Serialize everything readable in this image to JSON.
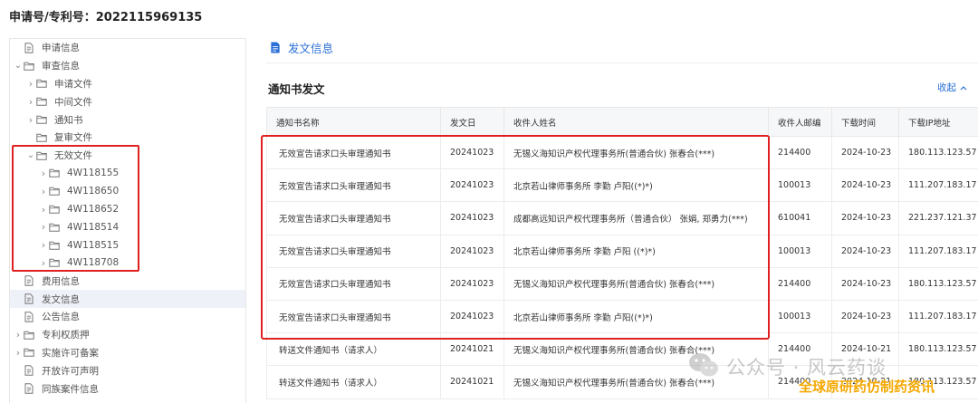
{
  "header": {
    "title": "申请号/专利号：2022115969135"
  },
  "sidebar": {
    "items": [
      {
        "label": "申请信息",
        "level": 0,
        "caret": "",
        "icon": "file"
      },
      {
        "label": "审查信息",
        "level": 0,
        "caret": "down",
        "icon": "folder"
      },
      {
        "label": "申请文件",
        "level": 1,
        "caret": "right",
        "icon": "folder"
      },
      {
        "label": "中间文件",
        "level": 1,
        "caret": "right",
        "icon": "folder"
      },
      {
        "label": "通知书",
        "level": 1,
        "caret": "right",
        "icon": "folder"
      },
      {
        "label": "复审文件",
        "level": 1,
        "caret": "",
        "icon": "folder"
      },
      {
        "label": "无效文件",
        "level": 1,
        "caret": "down",
        "icon": "folder"
      },
      {
        "label": "4W118155",
        "level": 2,
        "caret": "right",
        "icon": "folder"
      },
      {
        "label": "4W118650",
        "level": 2,
        "caret": "right",
        "icon": "folder"
      },
      {
        "label": "4W118652",
        "level": 2,
        "caret": "right",
        "icon": "folder"
      },
      {
        "label": "4W118514",
        "level": 2,
        "caret": "right",
        "icon": "folder"
      },
      {
        "label": "4W118515",
        "level": 2,
        "caret": "right",
        "icon": "folder"
      },
      {
        "label": "4W118708",
        "level": 2,
        "caret": "right",
        "icon": "folder"
      },
      {
        "label": "费用信息",
        "level": 0,
        "caret": "",
        "icon": "file"
      },
      {
        "label": "发文信息",
        "level": 0,
        "caret": "",
        "icon": "file",
        "active": true
      },
      {
        "label": "公告信息",
        "level": 0,
        "caret": "",
        "icon": "file"
      },
      {
        "label": "专利权质押",
        "level": 0,
        "caret": "right",
        "icon": "folder"
      },
      {
        "label": "实施许可备案",
        "level": 0,
        "caret": "right",
        "icon": "folder"
      },
      {
        "label": "开放许可声明",
        "level": 0,
        "caret": "",
        "icon": "file"
      },
      {
        "label": "同族案件信息",
        "level": 0,
        "caret": "",
        "icon": "file"
      }
    ]
  },
  "main": {
    "section_title": "发文信息",
    "sub_title": "通知书发文",
    "collapse_label": "收起",
    "table": {
      "columns": [
        "通知书名称",
        "发文日",
        "收件人姓名",
        "收件人邮编",
        "下载时间",
        "下载IP地址"
      ],
      "rows": [
        [
          "无效宣告请求口头审理通知书",
          "20241023",
          "无锡义海知识产权代理事务所(普通合伙) 张春合(***)",
          "214400",
          "2024-10-23",
          "180.113.123.57"
        ],
        [
          "无效宣告请求口头审理通知书",
          "20241023",
          "北京若山律师事务所 李勤 卢阳((*)*)",
          "100013",
          "2024-10-23",
          "111.207.183.17"
        ],
        [
          "无效宣告请求口头审理通知书",
          "20241023",
          "成都高远知识产权代理事务所（普通合伙） 张娟, 郑勇力(***)",
          "610041",
          "2024-10-23",
          "221.237.121.37"
        ],
        [
          "无效宣告请求口头审理通知书",
          "20241023",
          "北京若山律师事务所 李勤 卢阳 ((*)*)",
          "100013",
          "2024-10-23",
          "111.207.183.17"
        ],
        [
          "无效宣告请求口头审理通知书",
          "20241023",
          "无锡义海知识产权代理事务所(普通合伙) 张春合(***)",
          "214400",
          "2024-10-23",
          "180.113.123.57"
        ],
        [
          "无效宣告请求口头审理通知书",
          "20241023",
          "北京若山律师事务所 李勤 卢阳((*)*)",
          "100013",
          "2024-10-23",
          "111.207.183.17"
        ],
        [
          "转送文件通知书（请求人）",
          "20241021",
          "无锡义海知识产权代理事务所(普通合伙) 张春合(***)",
          "214400",
          "2024-10-21",
          "180.113.123.57"
        ],
        [
          "转送文件通知书（请求人）",
          "20241021",
          "无锡义海知识产权代理事务所(普通合伙) 张春合(***)",
          "214400",
          "2024-10-21",
          "180.113.123.57"
        ]
      ]
    }
  },
  "watermark": {
    "text": "公众号 · 风云药谈",
    "icon": "wechat-icon"
  },
  "footer": {
    "text": "全球原研药仿制药资讯"
  },
  "colors": {
    "accent": "#2b6fd6",
    "highlight": "#e02020",
    "footer": "#f5a800"
  }
}
